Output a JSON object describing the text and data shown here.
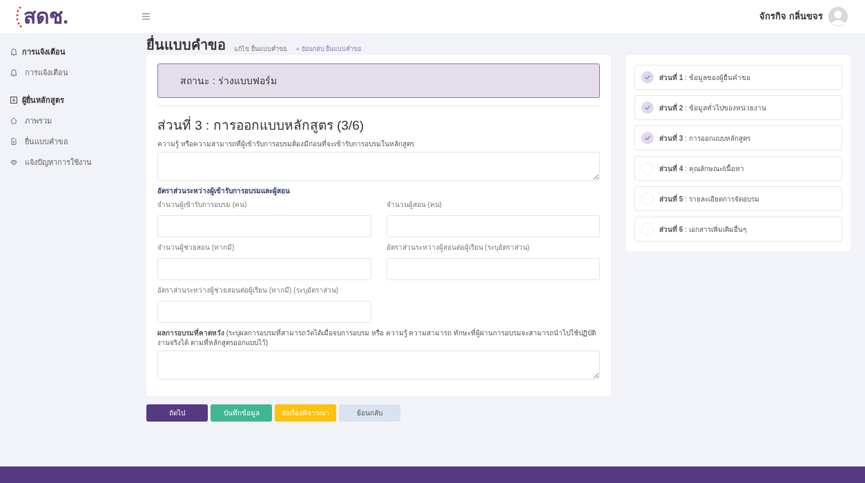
{
  "header": {
    "logo": "สดช.",
    "menu_icon": "≡",
    "user_name": "จักรกิจ กลิ่นขจร"
  },
  "sidebar": {
    "groups": [
      {
        "heading": "การแจ้งเตือน",
        "items": [
          {
            "label": "การแจ้งเตือน"
          }
        ]
      },
      {
        "heading": "ผู้ยื่นหลักสูตร",
        "items": [
          {
            "label": "ภาพรวม"
          },
          {
            "label": "ยื่นแบบคำขอ"
          },
          {
            "label": "แจ้งปัญหาการใช้งาน"
          }
        ]
      }
    ]
  },
  "page": {
    "title": "ยื่นแบบคำขอ",
    "breadcrumb": "แก้ไข ยื่นแบบคำขอ.",
    "back_link": "« ย้อนกลับ ยื่นแบบคำขอ"
  },
  "status": "สถานะ : ร่างแบบฟอร์ม",
  "section_title": "ส่วนที่ 3 : การออกแบบหลักสูตร (3/6)",
  "fields": [
    {
      "kind": "textarea",
      "label": "ความรู้ หรือความสามารถที่ผู้เข้ารับการอบรมต้องมีก่อนที่จะเข้ารับการอบรมในหลักสูตร"
    },
    {
      "kind": "heading",
      "label": "อัตราส่วนระหว่างผู้เข้ารับการอบรมและผู้สอน"
    },
    {
      "kind": "input",
      "label": "จำนวนผู้เข้ารับการอบรม (คน)"
    },
    {
      "kind": "input",
      "label": "จำนวนผู้สอน (คน)"
    },
    {
      "kind": "input",
      "label": "จำนวนผู้ช่วยสอน (หากมี)"
    },
    {
      "kind": "input",
      "label": "อัตราส่วนระหว่างผู้สอนต่อผู้เรียน (ระบุอัตราส่วน)"
    },
    {
      "kind": "input",
      "label": "อัตราส่วนระหว่างผู้ช่วยสอนต่อผู้เรียน (หากมี) (ระบุอัตราส่วน)"
    },
    {
      "kind": "textarea",
      "label": "**ผลการอบรมที่คาดหวัง** (ระบุผลการอบรมที่สามารถวัดได้เมื่อจบการอบรม หรือ ความรู้ ความสามารถ ทักษะที่ผู้ผ่านการอบรมจะสามารถนำไปใช้ปฏิบัติงานจริงได้ ตามที่หลักสูตรออกแบบไว้)"
    }
  ],
  "steps": [
    {
      "label": "**ส่วนที่ 1** : ข้อมูลของผู้ยื่นคำขอ",
      "checked": true
    },
    {
      "label": "**ส่วนที่ 2** : ข้อมูลทั่วไปของหน่วยงาน",
      "checked": true
    },
    {
      "label": "**ส่วนที่ 3** : การออกแบบหลักสูตร",
      "checked": true
    },
    {
      "label": "**ส่วนที่ 4** : คุณลักษณะ/เนื้อหา",
      "checked": false
    },
    {
      "label": "**ส่วนที่ 5** : รายละเอียดการจัดอบรม",
      "checked": false
    },
    {
      "label": "**ส่วนที่ 6** : เอกสารเพิ่มเติมอื่นๆ",
      "checked": false
    }
  ],
  "buttons": [
    {
      "kind": "primary",
      "label": "ถัดไป"
    },
    {
      "kind": "success",
      "label": "บันทึกข้อมูล"
    },
    {
      "kind": "warning",
      "label": "ส่งเรื่องพิจารณา"
    },
    {
      "kind": "secondary",
      "label": "ย้อนกลับ"
    }
  ]
}
